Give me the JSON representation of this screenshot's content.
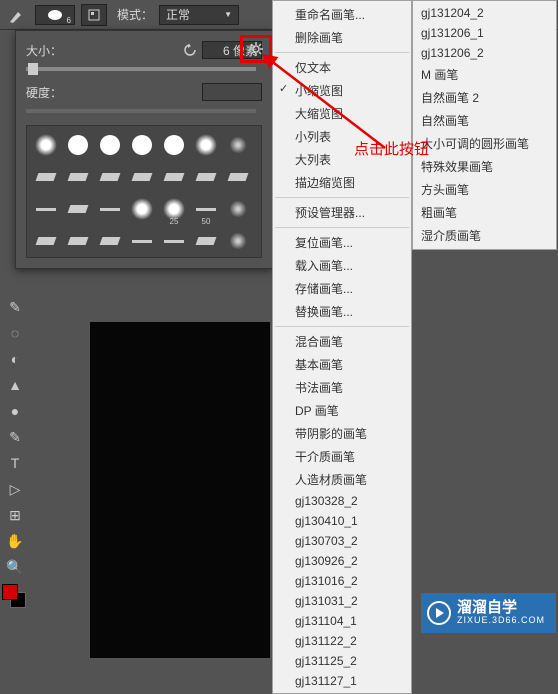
{
  "toolbar": {
    "brush_size_under": "6",
    "mode_label": "模式：",
    "mode_value": "正常"
  },
  "brush_panel": {
    "size_label": "大小：",
    "size_value": "6 像素",
    "hardness_label": "硬度：",
    "thumb_sizes": [
      "",
      "",
      "",
      "",
      "",
      "",
      "",
      "",
      "",
      "",
      "",
      "",
      "",
      "",
      "",
      "",
      "",
      "",
      "25",
      "50",
      ""
    ]
  },
  "tools": [
    "✎",
    "◌",
    "◐",
    "▲",
    "●",
    "✎",
    "T",
    "▷",
    "⊞",
    "✋",
    "🔍"
  ],
  "context_menu": {
    "items": [
      {
        "label": "重命名画笔...",
        "group": 0
      },
      {
        "label": "删除画笔",
        "group": 0
      },
      {
        "label": "仅文本",
        "group": 1
      },
      {
        "label": "小缩览图",
        "group": 1,
        "checked": true
      },
      {
        "label": "大缩览图",
        "group": 1
      },
      {
        "label": "小列表",
        "group": 1
      },
      {
        "label": "大列表",
        "group": 1
      },
      {
        "label": "描边缩览图",
        "group": 1
      },
      {
        "label": "预设管理器...",
        "group": 2
      },
      {
        "label": "复位画笔...",
        "group": 3
      },
      {
        "label": "载入画笔...",
        "group": 3
      },
      {
        "label": "存储画笔...",
        "group": 3
      },
      {
        "label": "替换画笔...",
        "group": 3
      },
      {
        "label": "混合画笔",
        "group": 4
      },
      {
        "label": "基本画笔",
        "group": 4
      },
      {
        "label": "书法画笔",
        "group": 4
      },
      {
        "label": "DP 画笔",
        "group": 4
      },
      {
        "label": "带阴影的画笔",
        "group": 4
      },
      {
        "label": "干介质画笔",
        "group": 4
      },
      {
        "label": "人造材质画笔",
        "group": 4
      },
      {
        "label": "gj130328_2",
        "group": 4
      },
      {
        "label": "gj130410_1",
        "group": 4
      },
      {
        "label": "gj130703_2",
        "group": 4
      },
      {
        "label": "gj130926_2",
        "group": 4
      },
      {
        "label": "gj131016_2",
        "group": 4
      },
      {
        "label": "gj131031_2",
        "group": 4
      },
      {
        "label": "gj131104_1",
        "group": 4
      },
      {
        "label": "gj131122_2",
        "group": 4
      },
      {
        "label": "gj131125_2",
        "group": 4
      },
      {
        "label": "gj131127_1",
        "group": 4
      }
    ]
  },
  "preset_menu": {
    "items": [
      "gj131204_2",
      "gj131206_1",
      "gj131206_2",
      "M 画笔",
      "自然画笔 2",
      "自然画笔",
      "大小可调的圆形画笔",
      "特殊效果画笔",
      "方头画笔",
      "粗画笔",
      "湿介质画笔"
    ]
  },
  "annotation": "点击此按钮",
  "watermark": {
    "title": "溜溜自学",
    "sub": "ZIXUE.3D66.COM"
  }
}
